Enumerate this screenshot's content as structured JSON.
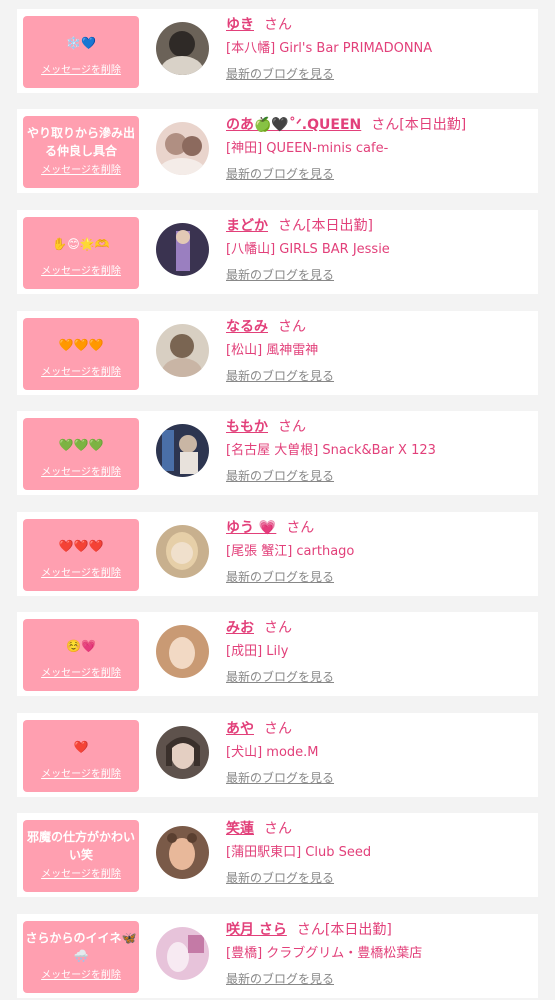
{
  "delete_label": "メッセージを削除",
  "san_label": "さん",
  "blog_label": "最新のブログを見る",
  "items": [
    {
      "msg": "❄️💙",
      "name": "ゆき",
      "status": "",
      "shop": "[本八幡] Girl's Bar PRIMADONNA",
      "avatar_bg": "#6b6258",
      "avatar_fg": "#d9d2c8"
    },
    {
      "msg": "やり取りから滲み出る仲良し具合",
      "name": "のあ🍏🖤˚ᐟ.QUEEN",
      "status": "[本日出勤]",
      "shop": "[神田] QUEEN-minis cafe-",
      "avatar_bg": "#e9d4cc",
      "avatar_fg": "#b08f82"
    },
    {
      "msg": "✋😊🌟🫶",
      "name": "まどか",
      "status": "[本日出勤]",
      "shop": "[八幡山] GIRLS BAR Jessie",
      "avatar_bg": "#3a3350",
      "avatar_fg": "#9a7fc0"
    },
    {
      "msg": "🧡🧡🧡",
      "name": "なるみ",
      "status": "",
      "shop": "[松山] 風神雷神",
      "avatar_bg": "#d8cfc2",
      "avatar_fg": "#7a6552"
    },
    {
      "msg": "💚💚💚",
      "name": "ももか",
      "status": "",
      "shop": "[名古屋 大曽根] Snack&Bar X 123",
      "avatar_bg": "#2d3550",
      "avatar_fg": "#c9b6a4"
    },
    {
      "msg": "❤️❤️❤️",
      "name": "ゆう 💗",
      "status": "",
      "shop": "[尾張 蟹江] carthago",
      "avatar_bg": "#c8b08e",
      "avatar_fg": "#f0e0cc"
    },
    {
      "msg": "☺️💗",
      "name": "みお",
      "status": "",
      "shop": "[成田] Lily",
      "avatar_bg": "#c99a74",
      "avatar_fg": "#f2d9c4"
    },
    {
      "msg": "❤️",
      "name": "あや",
      "status": "",
      "shop": "[犬山] mode.M",
      "avatar_bg": "#5e524c",
      "avatar_fg": "#e4cfc2"
    },
    {
      "msg": "邪魔の仕方がかわいい笑",
      "name": "笑蓮",
      "status": "",
      "shop": "[蒲田駅東口] Club Seed",
      "avatar_bg": "#7a5a48",
      "avatar_fg": "#e8b89a"
    },
    {
      "msg": "さらからのイイネ🦋🌨️",
      "name": "咲月 さら",
      "status": "[本日出勤]",
      "shop": "[豊橋] クラブグリム・豊橋松葉店",
      "avatar_bg": "#e7c3da",
      "avatar_fg": "#f7eaf2"
    }
  ]
}
